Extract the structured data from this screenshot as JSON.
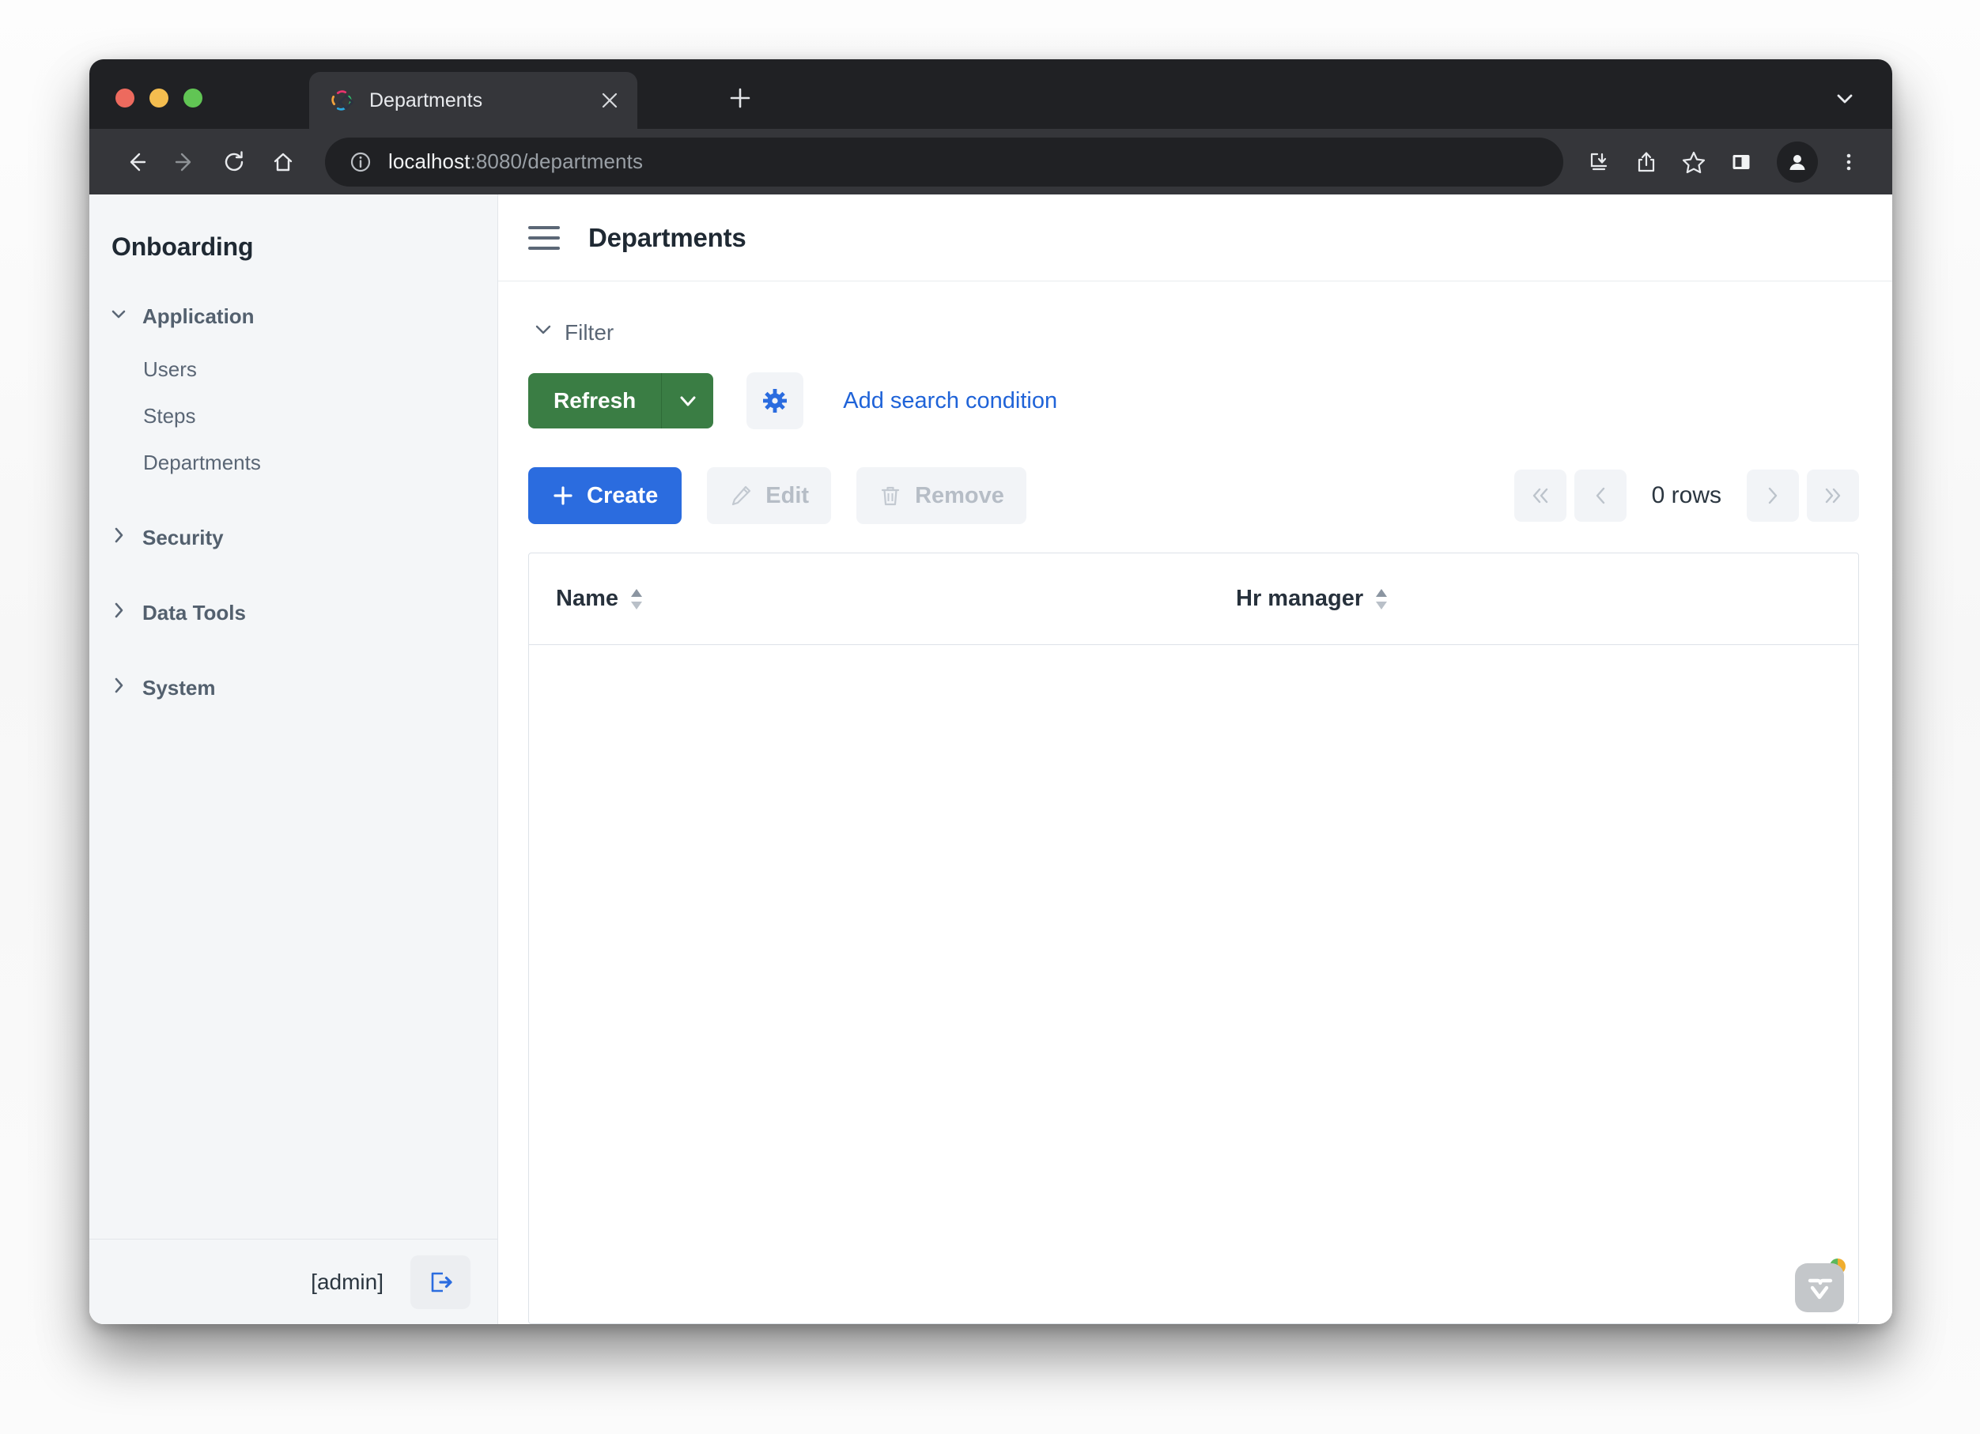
{
  "browser": {
    "tab": {
      "title": "Departments",
      "favicon_icon": "vaadin-diamond-favicon",
      "close_icon": "close-icon"
    },
    "new_tab_icon": "plus-icon",
    "tab_list_chevron_icon": "chevron-down-icon",
    "nav": {
      "back_icon": "arrow-left-icon",
      "forward_icon": "arrow-right-icon",
      "reload_icon": "reload-icon",
      "home_icon": "home-icon"
    },
    "omnibox": {
      "info_icon": "info-circle-icon",
      "host": "localhost",
      "path": ":8080/departments",
      "full_url": "localhost:8080/departments"
    },
    "toolbar_icons": [
      "install-app-icon",
      "share-icon",
      "bookmark-star-icon",
      "side-panel-icon",
      "profile-avatar-icon",
      "kebab-menu-icon"
    ]
  },
  "sidebar": {
    "brand": "Onboarding",
    "groups": [
      {
        "label": "Application",
        "expanded": true,
        "chevron": "chevron-down-icon",
        "children": [
          "Users",
          "Steps",
          "Departments"
        ]
      },
      {
        "label": "Security",
        "expanded": false,
        "chevron": "chevron-right-icon",
        "children": []
      },
      {
        "label": "Data Tools",
        "expanded": false,
        "chevron": "chevron-right-icon",
        "children": []
      },
      {
        "label": "System",
        "expanded": false,
        "chevron": "chevron-right-icon",
        "children": []
      }
    ],
    "footer": {
      "user": "[admin]",
      "logout_icon": "logout-icon"
    }
  },
  "main": {
    "burger_icon": "hamburger-menu-icon",
    "title": "Departments",
    "filter": {
      "label": "Filter",
      "chevron": "chevron-down-icon",
      "expanded": true
    },
    "actions": {
      "refresh_label": "Refresh",
      "refresh_split_icon": "chevron-down-icon",
      "settings_icon": "gear-icon",
      "add_condition_label": "Add search condition"
    },
    "crud": {
      "create_label": "Create",
      "create_icon": "plus-icon",
      "edit_label": "Edit",
      "edit_icon": "pencil-icon",
      "edit_disabled": true,
      "remove_label": "Remove",
      "remove_icon": "trash-icon",
      "remove_disabled": true
    },
    "pagination": {
      "first_icon": "double-chevron-left-icon",
      "prev_icon": "chevron-left-icon",
      "count_label": "0 rows",
      "next_icon": "chevron-right-icon",
      "last_icon": "double-chevron-right-icon"
    },
    "grid": {
      "columns": [
        {
          "label": "Name",
          "sort_icon": "sort-updown-icon"
        },
        {
          "label": "Hr manager",
          "sort_icon": "sort-updown-icon"
        }
      ],
      "rows": []
    },
    "dev_badge": {
      "icon": "vaadin-logo-icon",
      "status_dot": "split-green-orange-dot"
    }
  },
  "colors": {
    "refresh_green": "#3a7d44",
    "create_blue": "#2b6cdf",
    "link_blue": "#1f63d8",
    "sidebar_bg": "#f4f6f8",
    "chrome_dark": "#202124",
    "chrome_toolbar": "#35363a"
  }
}
